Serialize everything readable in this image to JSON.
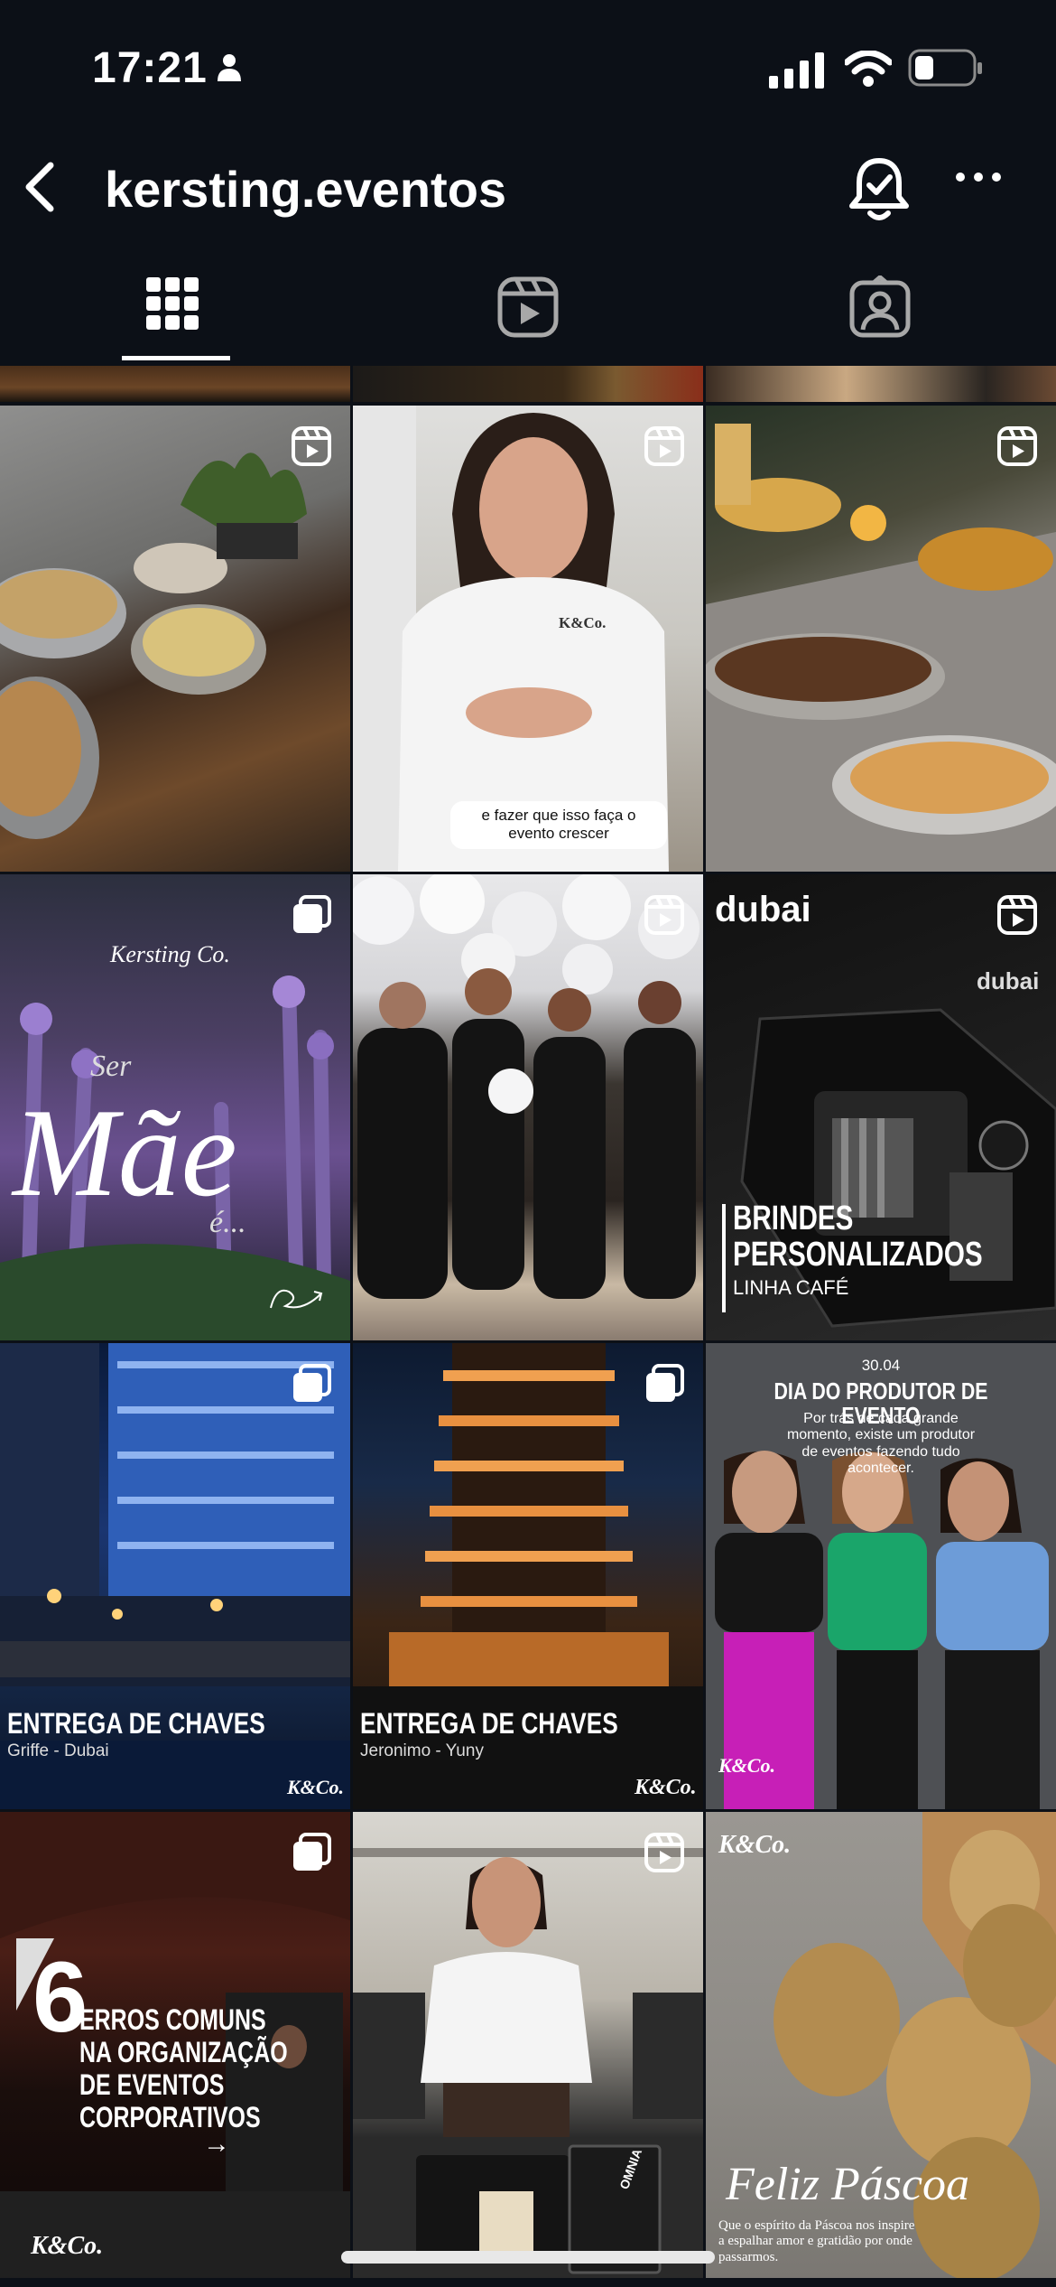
{
  "status_bar": {
    "time": "17:21"
  },
  "header": {
    "username": "kersting.eventos"
  },
  "tabs": [
    "posts-grid",
    "reels",
    "tagged"
  ],
  "posts": [
    {
      "type": "reel"
    },
    {
      "type": "reel",
      "caption": "e fazer que isso faça o evento crescer"
    },
    {
      "type": "reel"
    },
    {
      "type": "carousel",
      "brand": "Kersting Co.",
      "script_small": "Ser",
      "script_big": "Mãe",
      "script_end": "é..."
    },
    {
      "type": "reel"
    },
    {
      "type": "reel",
      "brand": "dubai",
      "brand2": "dubai",
      "title_line1": "BRINDES",
      "title_line2": "PERSONALIZADOS",
      "subtitle": "LINHA CAFÉ"
    },
    {
      "type": "carousel",
      "title": "ENTREGA DE CHAVES",
      "subtitle": "Griffe - Dubai",
      "logo": "K&Co."
    },
    {
      "type": "carousel",
      "title": "ENTREGA DE CHAVES",
      "subtitle": "Jeronimo - Yuny",
      "logo": "K&Co."
    },
    {
      "type": "image",
      "date": "30.04",
      "title": "DIA DO PRODUTOR DE EVENTO",
      "text": "Por trás de cada grande momento, existe um produtor de eventos fazendo tudo acontecer.",
      "logo": "K&Co."
    },
    {
      "type": "carousel",
      "number": "6",
      "line1": "ERROS COMUNS",
      "line2": "NA ORGANIZAÇÃO",
      "line3": "DE EVENTOS",
      "line4": "CORPORATIVOS",
      "arrow": "→",
      "logo": "K&Co."
    },
    {
      "type": "reel",
      "box_label": "OMNIA"
    },
    {
      "type": "image",
      "logo": "K&Co.",
      "script": "Feliz Páscoa",
      "text": "Que o espírito da Páscoa nos inspire a espalhar amor e gratidão por onde passarmos."
    }
  ],
  "tile_shirt_logo": "K&Co.",
  "colors": {
    "background": "#0c1017",
    "text": "#ffffff"
  }
}
